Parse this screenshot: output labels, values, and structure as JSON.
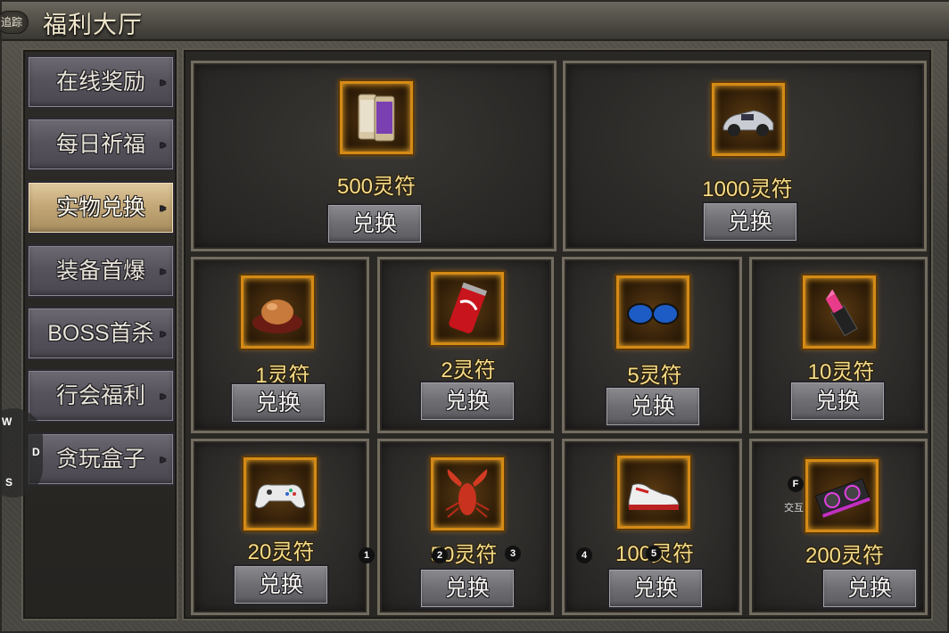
{
  "window": {
    "title": "福利大厅",
    "trace_label": "追踪"
  },
  "sidebar": {
    "items": [
      {
        "label": "在线奖励",
        "active": false
      },
      {
        "label": "每日祈福",
        "active": false
      },
      {
        "label": "实物兑换",
        "active": true
      },
      {
        "label": "装备首爆",
        "active": false
      },
      {
        "label": "BOSS首杀",
        "active": false
      },
      {
        "label": "行会福利",
        "active": false
      },
      {
        "label": "贪玩盒子",
        "active": false
      }
    ]
  },
  "rewards": {
    "button_label": "兑换",
    "items": [
      {
        "icon": "phone-icon",
        "price": "500灵符"
      },
      {
        "icon": "car-icon",
        "price": "1000灵符"
      },
      {
        "icon": "egg-icon",
        "price": "1灵符"
      },
      {
        "icon": "cola-can-icon",
        "price": "2灵符"
      },
      {
        "icon": "sunglasses-icon",
        "price": "5灵符"
      },
      {
        "icon": "lipstick-icon",
        "price": "10灵符"
      },
      {
        "icon": "gamepad-icon",
        "price": "20灵符"
      },
      {
        "icon": "lobster-icon",
        "price": "50灵符"
      },
      {
        "icon": "sneaker-icon",
        "price": "100灵符"
      },
      {
        "icon": "graphics-card-icon",
        "price": "200灵符"
      }
    ]
  },
  "overlay": {
    "joystick_keys": [
      "W",
      "D",
      "S"
    ],
    "hotkeys": [
      "1",
      "2",
      "3",
      "4",
      "5"
    ],
    "interact_key": "F",
    "interact_label": "交互"
  },
  "colors": {
    "price_gold": "#f4dc8a",
    "frame_orange": "#d48a16",
    "active_tab": "#c4a877"
  }
}
